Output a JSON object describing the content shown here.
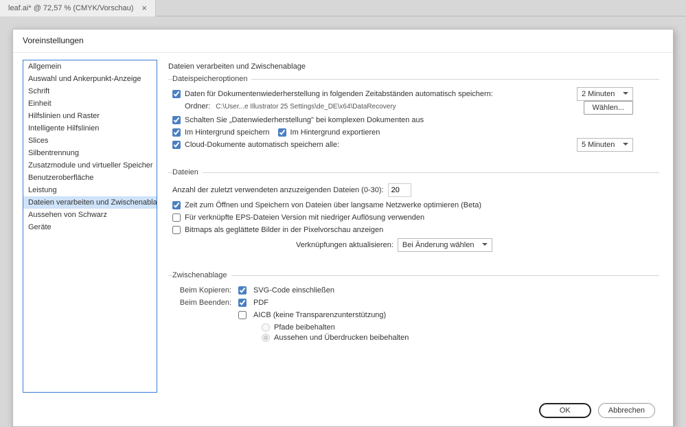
{
  "tab": {
    "title": "leaf.ai* @ 72,57 % (CMYK/Vorschau)"
  },
  "dialog": {
    "title": "Voreinstellungen"
  },
  "sidebar": {
    "items": [
      "Allgemein",
      "Auswahl und Ankerpunkt-Anzeige",
      "Schrift",
      "Einheit",
      "Hilfslinien und Raster",
      "Intelligente Hilfslinien",
      "Slices",
      "Silbentrennung",
      "Zusatzmodule und virtueller Speicher",
      "Benutzeroberfläche",
      "Leistung",
      "Dateien verarbeiten und Zwischenablage",
      "Aussehen von Schwarz",
      "Geräte"
    ],
    "selected": 11
  },
  "page_title": "Dateien verarbeiten und Zwischenablage",
  "section_storage": {
    "legend": "Dateispeicheroptionen",
    "auto_recover": "Daten für Dokumentenwiederherstellung in folgenden Zeitabständen automatisch speichern:",
    "interval_value": "2 Minuten",
    "folder_label": "Ordner:",
    "folder_path": "C:\\User...e Illustrator 25 Settings\\de_DE\\x64\\DataRecovery",
    "choose_btn": "Wählen...",
    "disable_complex": "Schalten Sie „Datenwiederherstellung\" bei komplexen Dokumenten aus",
    "bg_save": "Im Hintergrund speichern",
    "bg_export": "Im Hintergrund exportieren",
    "cloud_auto": "Cloud-Dokumente automatisch speichern alle:",
    "cloud_interval": "5 Minuten"
  },
  "section_files": {
    "legend": "Dateien",
    "recent_label": "Anzahl der zuletzt verwendeten anzuzeigenden Dateien (0-30):",
    "recent_value": "20",
    "slow_net": "Zeit zum Öffnen und Speichern von Dateien über langsame Netzwerke optimieren (Beta)",
    "eps_lowres": "Für verknüpfte EPS-Dateien Version mit niedriger Auflösung verwenden",
    "bitmap_aa": "Bitmaps als geglättete Bilder in der Pixelvorschau anzeigen",
    "links_update_label": "Verknüpfungen aktualisieren:",
    "links_update_value": "Bei Änderung wählen"
  },
  "section_clipboard": {
    "legend": "Zwischenablage",
    "on_copy": "Beim Kopieren:",
    "svg": "SVG-Code einschließen",
    "on_quit": "Beim Beenden:",
    "pdf": "PDF",
    "aicb": "AICB (keine Transparenzunterstützung)",
    "paths": "Pfade beibehalten",
    "appearance": "Aussehen und Überdrucken beibehalten"
  },
  "buttons": {
    "ok": "OK",
    "cancel": "Abbrechen"
  }
}
